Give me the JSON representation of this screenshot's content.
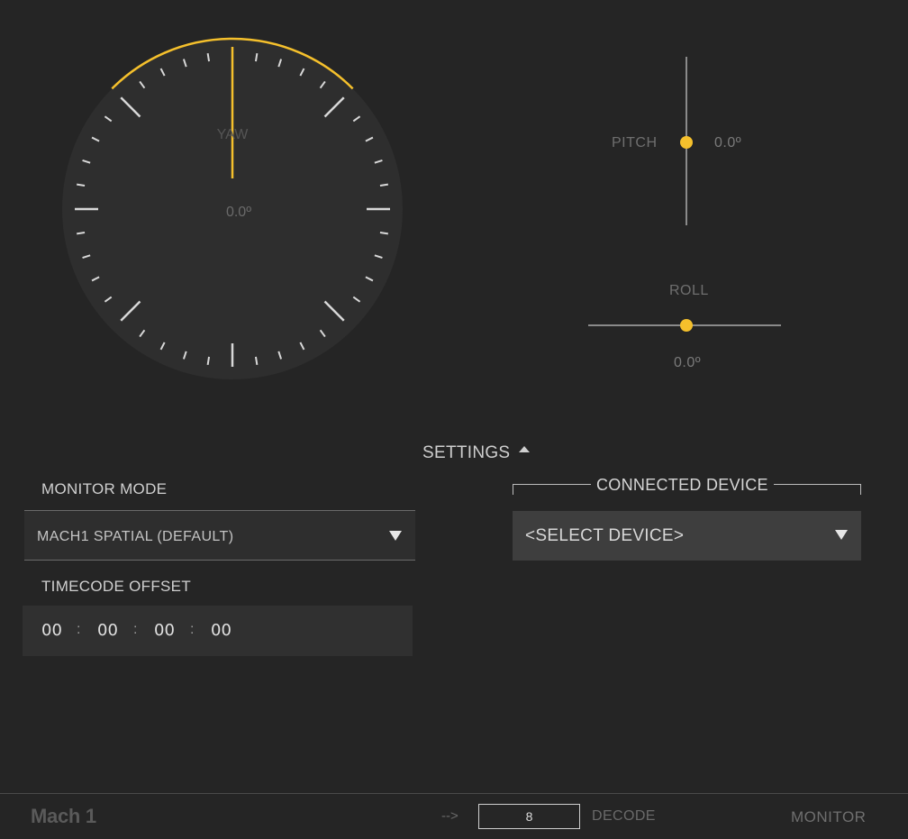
{
  "orientation": {
    "yaw": {
      "label": "YAW",
      "value_text": "0.0º",
      "value": 0.0
    },
    "pitch": {
      "label": "PITCH",
      "value_text": "0.0º",
      "value": 0.0
    },
    "roll": {
      "label": "ROLL",
      "value_text": "0.0º",
      "value": 0.0
    }
  },
  "colors": {
    "accent": "#f5c02c",
    "background": "#252525"
  },
  "settings": {
    "toggle_label": "SETTINGS",
    "toggle_icon": "caret-up-icon",
    "monitor_mode": {
      "label": "MONITOR MODE",
      "selected": "MACH1 SPATIAL (DEFAULT)"
    },
    "timecode_offset": {
      "label": "TIMECODE OFFSET",
      "hours": "00",
      "minutes": "00",
      "seconds": "00",
      "frames": "00",
      "separator": ":"
    },
    "connected_device": {
      "label": "CONNECTED DEVICE",
      "selected": "<SELECT DEVICE>"
    }
  },
  "footer": {
    "brand": "Mach 1",
    "arrow": "-->",
    "decode_value": "8",
    "decode_label": "DECODE",
    "monitor_label": "MONITOR"
  }
}
